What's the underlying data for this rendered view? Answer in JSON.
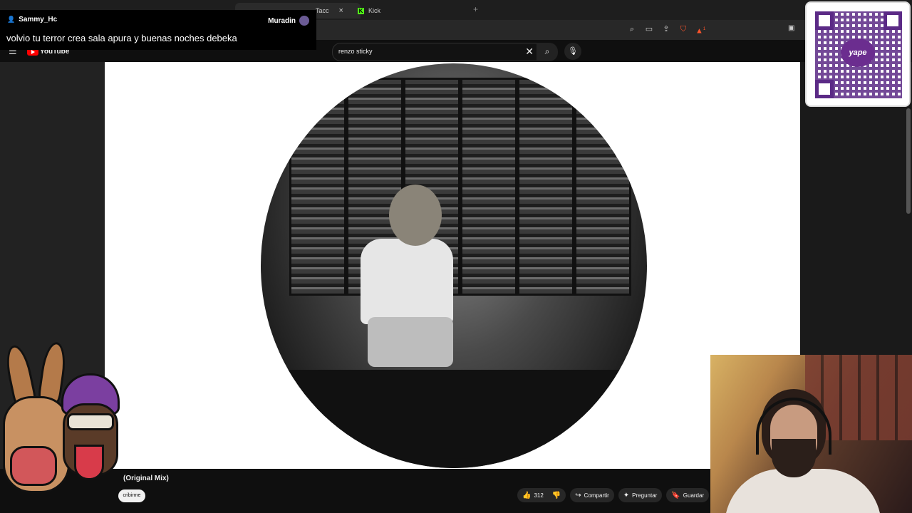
{
  "browser": {
    "tabs": [
      {
        "label": "Tacc"
      },
      {
        "label": "Kick"
      }
    ],
    "tab_close": "×",
    "new_tab": "+",
    "brave_badge": "1"
  },
  "youtube": {
    "logo_text": "YouTube",
    "search": {
      "value": "renzo sticky",
      "clear": "✕"
    }
  },
  "video": {
    "title_fragment": "(Original Mix)",
    "subscribe_fragment": "cribirme",
    "actions": {
      "likes": "312",
      "share": "Compartir",
      "ask": "Preguntar",
      "save": "Guardar"
    }
  },
  "chat": {
    "username": "Sammy_Hc",
    "bot_name": "Muradin",
    "message": "volvio tu terror crea sala apura y buenas noches debeka"
  },
  "qr": {
    "brand": "yape"
  },
  "icons": {
    "menu": "menu-icon",
    "search": "search-icon",
    "mic": "mic-icon",
    "like": "thumbs-up-icon",
    "dislike": "thumbs-down-icon",
    "share": "share-icon",
    "ask": "sparkle-icon",
    "save": "bookmark-icon",
    "user": "user-icon"
  },
  "colors": {
    "kick_green": "#53fc18",
    "youtube_red": "#ff0000",
    "yape_purple": "#6b2d8f"
  }
}
